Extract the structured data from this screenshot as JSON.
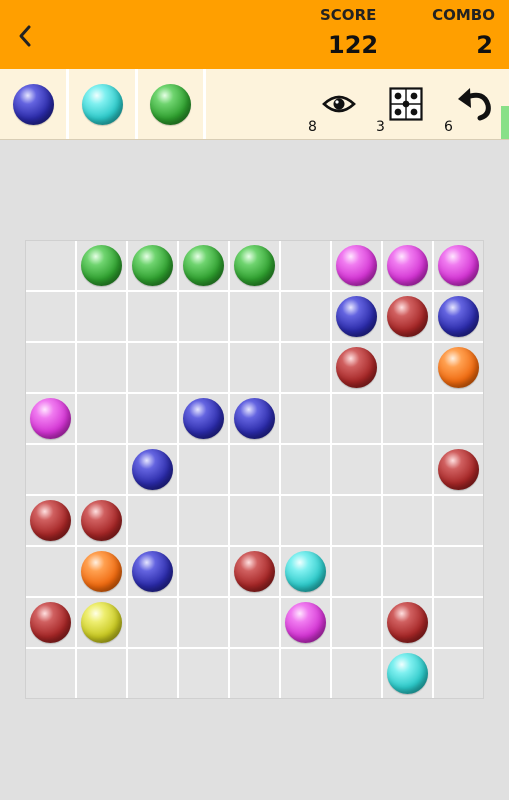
{
  "header": {
    "score_label": "SCORE",
    "score_value": "122",
    "combo_label": "COMBO",
    "combo_value": "2"
  },
  "next_balls": [
    "blue",
    "cyan",
    "green"
  ],
  "tools": {
    "hint_count": "8",
    "shuffle_count": "3",
    "undo_count": "6"
  },
  "colors": {
    "header_bg": "#ff9f00",
    "toolbar_bg": "#fdf3dc",
    "board_line": "#ffffff",
    "cell_bg": "#e3e3e3"
  },
  "board": [
    [
      "",
      "green",
      "green",
      "green",
      "green",
      "",
      "magenta",
      "magenta",
      "magenta"
    ],
    [
      "",
      "",
      "",
      "",
      "",
      "",
      "blue",
      "red",
      "blue"
    ],
    [
      "",
      "",
      "",
      "",
      "",
      "",
      "red",
      "",
      "orange"
    ],
    [
      "magenta",
      "",
      "",
      "blue",
      "blue",
      "",
      "",
      "",
      ""
    ],
    [
      "",
      "",
      "blue",
      "",
      "",
      "",
      "",
      "",
      "red"
    ],
    [
      "red",
      "red",
      "",
      "",
      "",
      "",
      "",
      "",
      ""
    ],
    [
      "",
      "orange",
      "blue",
      "",
      "red",
      "cyan",
      "",
      "",
      ""
    ],
    [
      "red",
      "yellow",
      "",
      "",
      "",
      "magenta",
      "",
      "red",
      ""
    ],
    [
      "",
      "",
      "",
      "",
      "",
      "",
      "",
      "cyan",
      ""
    ]
  ]
}
